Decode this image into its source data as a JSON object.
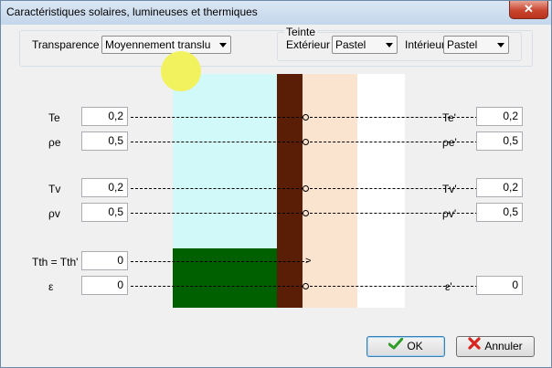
{
  "window": {
    "title": "Caractéristiques solaires, lumineuses et thermiques",
    "close_symbol": "✕"
  },
  "header": {
    "transparence_label": "Transparence",
    "transparence_value": "Moyennement translu",
    "teinte_group_label": "Teinte",
    "exterieur_label": "Extérieur",
    "exterieur_value": "Pastel",
    "interieur_label": "Intérieur",
    "interieur_value": "Pastel"
  },
  "rows_left": [
    {
      "label": "Te",
      "value": "0,2"
    },
    {
      "label": "ρe",
      "value": "0,5"
    },
    {
      "label": "Tv",
      "value": "0,2"
    },
    {
      "label": "ρv",
      "value": "0,5"
    },
    {
      "label": "Tth = Tth'",
      "value": "0"
    },
    {
      "label": "ε",
      "value": "0"
    }
  ],
  "rows_right": [
    {
      "label": "Te'",
      "value": "0,2"
    },
    {
      "label": "ρe'",
      "value": "0,5"
    },
    {
      "label": "Tv'",
      "value": "0,2"
    },
    {
      "label": "ρv'",
      "value": "0,5"
    },
    {
      "label": "ε'",
      "value": "0"
    }
  ],
  "illustration": {
    "sky_color": "#d1f9f9",
    "sun_color": "#f2f25e",
    "ground_color": "#006000",
    "wall_color": "#5a1e06",
    "interior_color": "#fbe4cf",
    "room_color": "#ffffff",
    "arrowhead_symbol": ">"
  },
  "buttons": {
    "ok_label": "OK",
    "cancel_label": "Annuler",
    "ok_icon": "check-icon",
    "cancel_icon": "cross-icon"
  }
}
